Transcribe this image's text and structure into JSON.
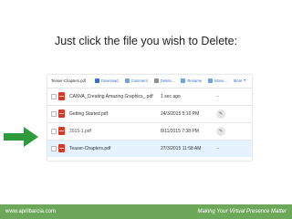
{
  "headline": "Just click the file you wish to Delete:",
  "toolbar": {
    "selected_file": "Teaser-Chapters.pdf",
    "actions": [
      {
        "label": "Download",
        "icon": "download-icon",
        "color": "#3a6ec7"
      },
      {
        "label": "Comment",
        "icon": "comment-icon",
        "color": "#6fa4e0"
      },
      {
        "label": "Delete...",
        "icon": "trash-icon",
        "color": "#8a8f96"
      },
      {
        "label": "Rename",
        "icon": "rename-icon",
        "color": "#6fa4e0"
      },
      {
        "label": "Move...",
        "icon": "move-icon",
        "color": "#6fa4e0"
      }
    ],
    "more": "More"
  },
  "files": [
    {
      "name": "CANVA_Creating Amazing Graphics_.pdf",
      "modified": "1 sec ago",
      "action": "--",
      "selected": false
    },
    {
      "name": "Getting Started.pdf",
      "modified": "24/3/2015 5:10 PM",
      "action": "pencil",
      "selected": false
    },
    {
      "name": "2015-1.pdf",
      "modified": "8/11/2015 7:38 PM",
      "action": "pencil",
      "selected": false
    },
    {
      "name": "Teaser-Chapters.pdf",
      "modified": "27/3/2015 11:58 AM",
      "action": "--",
      "selected": true
    }
  ],
  "footer": {
    "left": "www.aprilbarcia.com",
    "right": "Making Your Virtual Presence Matter"
  },
  "colors": {
    "accent_link": "#3a6ec7",
    "selected_row": "#e5f2ff",
    "arrow": "#2e9a3c",
    "footer_bg": "#6da85a",
    "pdf_icon": "#d03b2a"
  }
}
